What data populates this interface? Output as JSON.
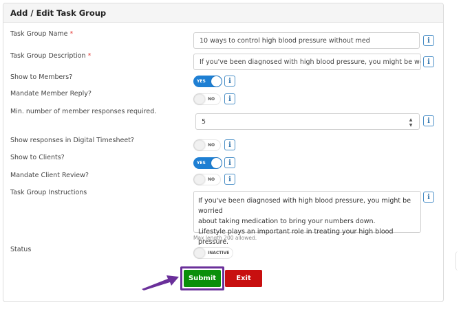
{
  "panel": {
    "title": "Add / Edit Task Group"
  },
  "fields": {
    "name": {
      "label": "Task Group Name",
      "required_mark": "*",
      "value": "10 ways to control high blood pressure without med",
      "info": "i"
    },
    "description": {
      "label": "Task Group Description",
      "required_mark": "*",
      "value": "If you've been diagnosed with high blood pressure, you might be worried about",
      "info": "i"
    },
    "show_members": {
      "label": "Show to Members?",
      "toggle": "YES",
      "state": "on",
      "info": "i"
    },
    "mandate_member_reply": {
      "label": "Mandate Member Reply?",
      "toggle": "NO",
      "state": "off",
      "info": "i"
    },
    "min_responses": {
      "label": "Min. number of member responses required.",
      "value": "5",
      "info": "i",
      "spin_up": "▲",
      "spin_down": "▼"
    },
    "show_timesheet": {
      "label": "Show responses in Digital Timesheet?",
      "toggle": "NO",
      "state": "off",
      "info": "i"
    },
    "show_clients": {
      "label": "Show to Clients?",
      "toggle": "YES",
      "state": "on",
      "info": "i"
    },
    "mandate_client_review": {
      "label": "Mandate Client Review?",
      "toggle": "NO",
      "state": "off",
      "info": "i"
    },
    "instructions": {
      "label": "Task Group Instructions",
      "line1": "If you've been diagnosed with high blood pressure, you might be worried",
      "line2": "about taking medication to bring your numbers down.",
      "line3": "Lifestyle plays an important role in treating your high blood pressure.",
      "hint": "Max length 200 allowed.",
      "info": "i"
    },
    "status": {
      "label": "Status",
      "toggle": "INACTIVE",
      "state": "off"
    }
  },
  "buttons": {
    "submit": "Submit",
    "exit": "Exit"
  },
  "colors": {
    "toggle_on": "#1e7fd3",
    "submit": "#0a8f0a",
    "exit": "#c80f0f",
    "highlight": "#6a2f9a",
    "info_border": "#4a8fc7"
  },
  "icons": {
    "info": "info-icon",
    "arrow": "pointer-arrow-icon",
    "spinner": "spinner-arrows-icon"
  }
}
